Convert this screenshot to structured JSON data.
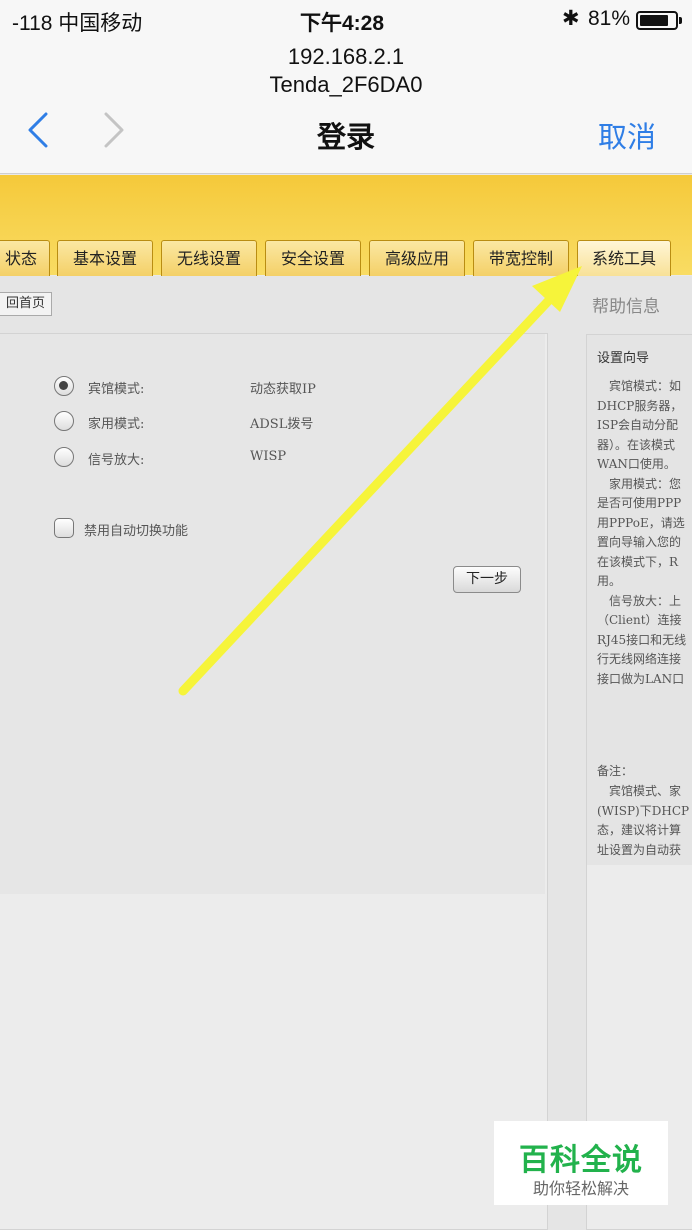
{
  "status_bar": {
    "carrier": "-118 中国移动",
    "time": "下午4:28",
    "battery_pct": "81%",
    "battery_level": 0.81
  },
  "browser": {
    "url": "192.168.2.1",
    "ssid": "Tenda_2F6DA0",
    "title": "登录",
    "cancel_label": "取消"
  },
  "router": {
    "tabs": [
      "状态",
      "基本设置",
      "无线设置",
      "安全设置",
      "高级应用",
      "带宽控制",
      "系统工具"
    ],
    "home_button": "回首页",
    "modes": [
      {
        "label": "宾馆模式:",
        "value": "动态获取IP",
        "checked": true
      },
      {
        "label": "家用模式:",
        "value": "ADSL拨号",
        "checked": false
      },
      {
        "label": "信号放大:",
        "value": "WISP",
        "checked": false
      }
    ],
    "auto_switch_label": "禁用自动切换功能",
    "next_button": "下一步"
  },
  "help": {
    "heading": "帮助信息",
    "title": "设置向导",
    "lines": [
      "　宾馆模式：如",
      "DHCP服务器，",
      "ISP会自动分配",
      "器）。在该模式",
      "WAN口使用。",
      "　家用模式：您",
      "是否可使用PPP",
      "用PPPoE，请选",
      "置向导输入您的",
      "在该模式下，R",
      "用。",
      "　信号放大：上",
      "（Client）连接",
      "RJ45接口和无线",
      "行无线网络连接",
      "接口做为LAN口"
    ],
    "note_title": "备注：",
    "note_lines": [
      "　宾馆模式、家",
      "(WISP)下DHCP",
      "态，建议将计算",
      "址设置为自动获"
    ]
  },
  "watermark": {
    "main": "百科全说",
    "sub": "助你轻松解决"
  },
  "colors": {
    "accent_blue": "#2f7ee6",
    "router_yellow": "#f5c93a",
    "annotation_arrow": "#f6f43a",
    "watermark_green": "#22b24c"
  }
}
